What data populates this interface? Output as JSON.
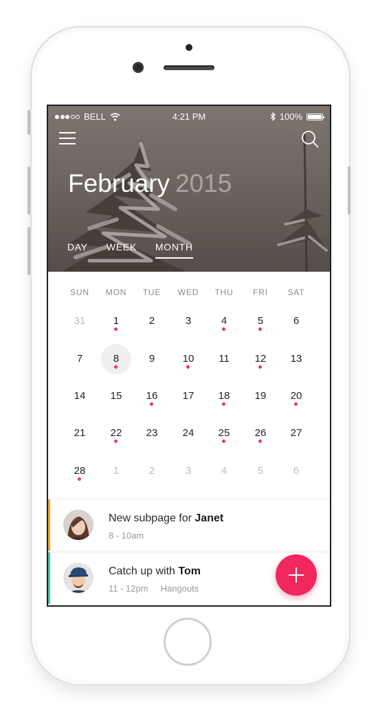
{
  "status_bar": {
    "carrier": "BELL",
    "time": "4:21 PM",
    "battery": "100%",
    "signal_bars": 3
  },
  "header": {
    "month": "February",
    "year": "2015",
    "tabs": [
      {
        "label": "DAY",
        "active": false
      },
      {
        "label": "WEEK",
        "active": false
      },
      {
        "label": "MONTH",
        "active": true
      }
    ]
  },
  "calendar": {
    "weekdays": [
      "SUN",
      "MON",
      "TUE",
      "WED",
      "THU",
      "FRI",
      "SAT"
    ],
    "weeks": [
      [
        {
          "d": "31",
          "muted": true
        },
        {
          "d": "1",
          "dot": true
        },
        {
          "d": "2"
        },
        {
          "d": "3"
        },
        {
          "d": "4",
          "dot": true
        },
        {
          "d": "5",
          "dot": true
        },
        {
          "d": "6"
        }
      ],
      [
        {
          "d": "7"
        },
        {
          "d": "8",
          "dot": true,
          "today": true
        },
        {
          "d": "9"
        },
        {
          "d": "10",
          "dot": true
        },
        {
          "d": "11"
        },
        {
          "d": "12",
          "dot": true
        },
        {
          "d": "13"
        }
      ],
      [
        {
          "d": "14"
        },
        {
          "d": "15"
        },
        {
          "d": "16",
          "dot": true
        },
        {
          "d": "17"
        },
        {
          "d": "18",
          "dot": true
        },
        {
          "d": "19"
        },
        {
          "d": "20",
          "dot": true
        }
      ],
      [
        {
          "d": "21"
        },
        {
          "d": "22",
          "dot": true
        },
        {
          "d": "23"
        },
        {
          "d": "24"
        },
        {
          "d": "25",
          "dot": true
        },
        {
          "d": "26",
          "dot": true
        },
        {
          "d": "27"
        }
      ],
      [
        {
          "d": "28",
          "dot": true
        },
        {
          "d": "1",
          "muted": true
        },
        {
          "d": "2",
          "muted": true
        },
        {
          "d": "3",
          "muted": true
        },
        {
          "d": "4",
          "muted": true
        },
        {
          "d": "5",
          "muted": true
        },
        {
          "d": "6",
          "muted": true
        }
      ]
    ]
  },
  "events": [
    {
      "title": "New subpage for ",
      "person": "Janet",
      "time": "8 - 10am",
      "location": "",
      "color": "#f5a623"
    },
    {
      "title": "Catch up with ",
      "person": "Tom",
      "time": "11 - 12pm",
      "location": "Hangouts",
      "color": "#3ec8a8"
    }
  ],
  "colors": {
    "accent": "#f2275e",
    "event_dot": "#f0326c"
  },
  "icons": {
    "menu": "hamburger-menu-icon",
    "search": "search-icon",
    "add": "plus-icon",
    "wifi": "wifi-icon",
    "bluetooth": "bluetooth-icon",
    "battery": "battery-icon"
  }
}
